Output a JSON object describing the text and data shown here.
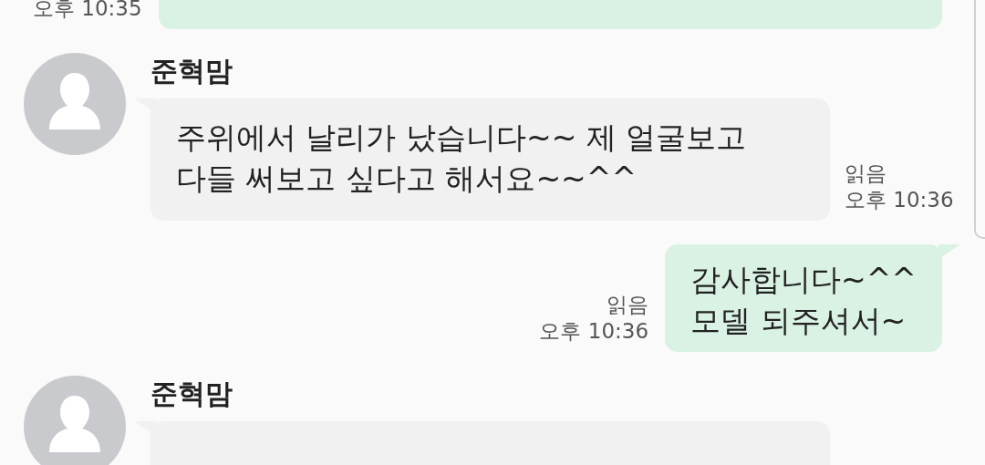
{
  "messages": [
    {
      "kind": "sent",
      "time": "오후 10:35"
    },
    {
      "kind": "received",
      "sender": "준혁맘",
      "text": "주위에서 날리가 났습니다~~ 제 얼굴보고\n다들 써보고 싶다고 해서요~~^^",
      "status": "읽음",
      "time": "오후 10:36"
    },
    {
      "kind": "sent",
      "text": "감사합니다~^^\n모델 되주셔서~",
      "status": "읽음",
      "time": "오후 10:36"
    },
    {
      "kind": "received",
      "sender": "준혁맘"
    }
  ]
}
